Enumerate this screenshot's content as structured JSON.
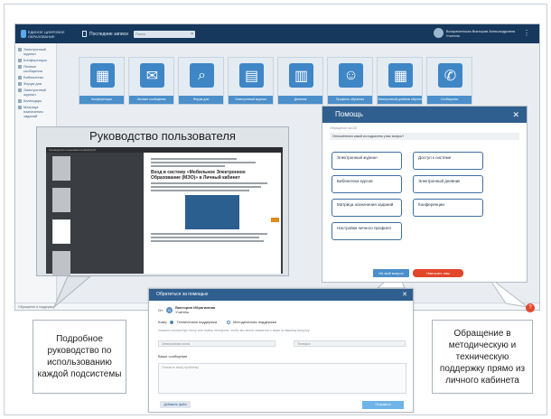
{
  "app": {
    "logo_text": "ЕДИНОЕ ЦИФРОВОЕ ОБРАЗОВАНИЕ",
    "topmenu_label": "Последние записи",
    "search_placeholder": "Поиск",
    "user_name": "Воскресенская Виктория Александровна",
    "user_role": "Учитель",
    "sidebar": [
      "Электронный журнал",
      "Конференции",
      "Личные сообщения",
      "Библиотека",
      "Форум для",
      "Электронный журнал",
      "Календарь",
      "Матрица назначения заданий"
    ],
    "tiles": [
      {
        "label": "Конференции",
        "icon": "presentation-icon"
      },
      {
        "label": "Личные сообщения",
        "icon": "envelope-icon"
      },
      {
        "label": "Форум для",
        "icon": "search-doc-icon"
      },
      {
        "label": "Электронный журнал",
        "icon": "calendar-grid-icon"
      },
      {
        "label": "Дневник",
        "icon": "calendar-icon"
      },
      {
        "label": "Профиль обучения",
        "icon": "head-icon"
      },
      {
        "label": "Электронный дневник обучения",
        "icon": "calculator-icon"
      },
      {
        "label": "Сообщения",
        "icon": "chat-icon"
      }
    ],
    "status_text": "Обращение в поддержку"
  },
  "guide": {
    "title": "Руководство пользователя",
    "viewer_bar": "Руководство пользователя (ЕЦО).pdf",
    "heading": "Вход в систему «Мобильное Электронное Образование (МЭО)» в Личный кабинет"
  },
  "help": {
    "title": "Помощь",
    "subtitle": "Обращение №135",
    "question": "Относительно какой из подсистем у вас вопрос?",
    "options": [
      "Электронный журнал",
      "Доступ к системе",
      "Библиотека курсов",
      "Электронный дневник",
      "Матрица назначения заданий",
      "Конференции",
      "Настройки личного профиля"
    ],
    "btn_back": "Не мой вопрос",
    "btn_write": "Написать нам"
  },
  "support": {
    "title": "Обратиться за помощью",
    "from_label": "От:",
    "user": "Виктория Ибрагимова",
    "user_sub": "Учитель",
    "to_label": "Кому:",
    "radio_tech": "Техническая поддержка",
    "radio_method": "Методическая поддержка",
    "hint": "Укажите контактную почту или номер телефона, чтобы мы могли связаться с вами по вашему вопросу",
    "email_placeholder": "Электронная почта",
    "phone_placeholder": "Телефон",
    "message_label": "Ваше сообщение",
    "message_placeholder": "Опишите вашу проблему",
    "attach_label": "Добавить файл",
    "send_label": "Отправить"
  },
  "captions": {
    "left": "Подробное руководство по использованию каждой подсистемы",
    "right": "Обращение в методическую и техническую поддержку прямо из личного кабинета"
  },
  "colors": {
    "topbar": "#16385c",
    "accent_blue": "#4b8fcb",
    "accent_red": "#e2462b"
  }
}
